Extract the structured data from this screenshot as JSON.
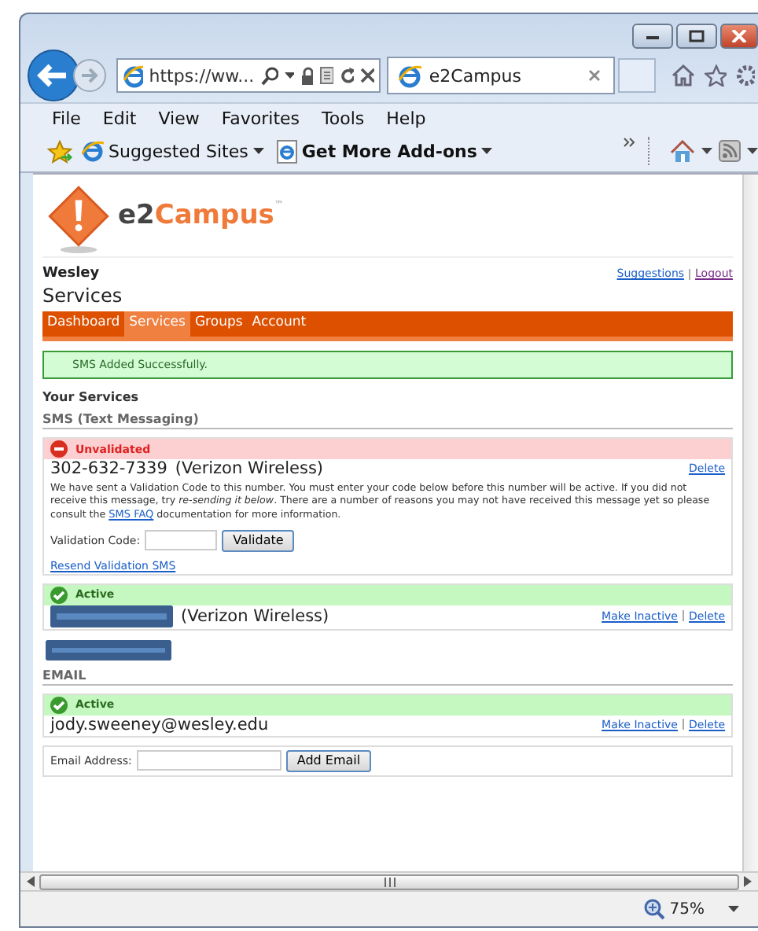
{
  "browser": {
    "address": "https://ww...",
    "tab_title": "e2Campus",
    "menu": [
      "File",
      "Edit",
      "View",
      "Favorites",
      "Tools",
      "Help"
    ],
    "favorites": [
      {
        "label": "Suggested Sites",
        "bold": false
      },
      {
        "label": "Get More Add-ons",
        "bold": true
      }
    ],
    "zoom": "75%"
  },
  "logo": {
    "prefix": "e2",
    "name": "Campus",
    "mark": "™"
  },
  "user": "Wesley",
  "links": [
    "Suggestions",
    "Logout"
  ],
  "heading": "Services",
  "nav": [
    {
      "label": "Dashboard",
      "selected": false
    },
    {
      "label": "Services",
      "selected": true
    },
    {
      "label": "Groups",
      "selected": false
    },
    {
      "label": "Account",
      "selected": false
    }
  ],
  "notice": "SMS Added Successfully.",
  "section_title": "Your Services",
  "sms": {
    "title": "SMS (Text Messaging)",
    "entries": [
      {
        "kind": "unvalidated",
        "status": "Unvalidated",
        "number": "302-632-7339",
        "carrier": "(Verizon Wireless)",
        "actions": [
          "Delete"
        ],
        "message_before": "We have sent a Validation Code to this number. You must enter your code below before this number will be active. If you did not receive this message, try *re-sending it below*. There are a number of reasons you may not have received this message yet so please consult the",
        "message_link": "SMS FAQ",
        "message_after": "documentation for more information.",
        "code_label": "Validation Code:",
        "code_button": "Validate",
        "resend": "Resend Validation SMS"
      },
      {
        "kind": "active",
        "status": "Active",
        "carrier": "(Verizon Wireless)",
        "actions": [
          "Make Inactive",
          "Delete"
        ]
      }
    ]
  },
  "email": {
    "title": "EMAIL",
    "entries": [
      {
        "kind": "active",
        "status": "Active",
        "address": "jody.sweeney@wesley.edu",
        "actions": [
          "Make Inactive",
          "Delete"
        ]
      }
    ],
    "form_label": "Email Address:",
    "form_button": "Add Email"
  }
}
